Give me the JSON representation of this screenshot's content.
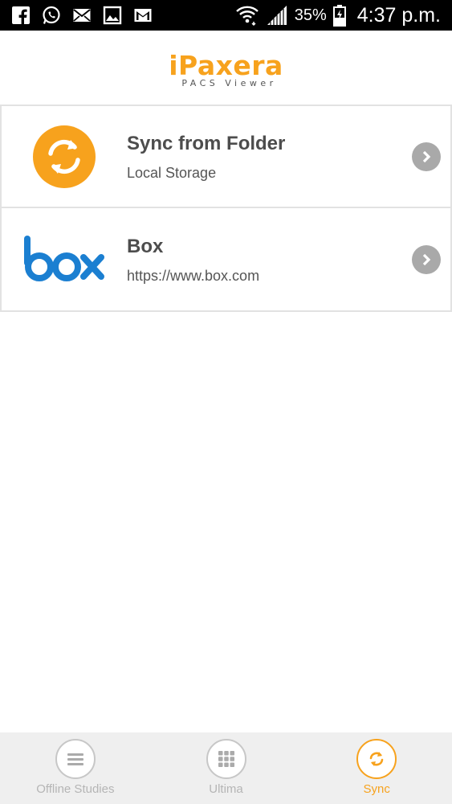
{
  "status_bar": {
    "battery": "35%",
    "time": "4:37 p.m.",
    "notification_icons": [
      "facebook-icon",
      "whatsapp-icon",
      "mail-icon",
      "image-icon",
      "gmail-icon"
    ],
    "system_icons": [
      "wifi-icon",
      "signal-icon",
      "battery-icon"
    ]
  },
  "header": {
    "logo_i": "i",
    "logo_rest": "Paxera",
    "logo_sub": "PACS Viewer"
  },
  "sync_sources": [
    {
      "title": "Sync from Folder",
      "subtitle": "Local Storage",
      "icon": "sync-folder-icon"
    },
    {
      "title": "Box",
      "subtitle": "https://www.box.com",
      "icon": "box-logo"
    }
  ],
  "tabs": [
    {
      "label": "Offline Studies",
      "icon": "menu-lines-icon",
      "active": false
    },
    {
      "label": "Ultima",
      "icon": "grid-icon",
      "active": false
    },
    {
      "label": "Sync",
      "icon": "sync-icon",
      "active": true
    }
  ],
  "colors": {
    "accent": "#f7a21d",
    "box_blue": "#1b7fd1",
    "chevron_grey": "#a9a9a9",
    "tab_bar_bg": "#efefef",
    "status_bar_bg": "#000000"
  }
}
